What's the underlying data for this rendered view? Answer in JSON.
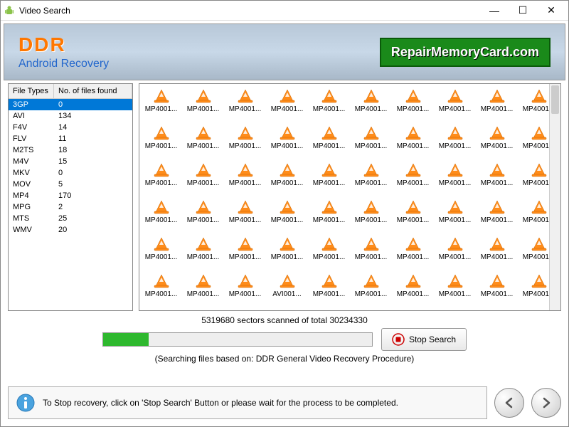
{
  "window": {
    "title": "Video Search"
  },
  "header": {
    "logo": "DDR",
    "subtitle": "Android Recovery",
    "brand": "RepairMemoryCard.com"
  },
  "file_table": {
    "col1": "File Types",
    "col2": "No. of files found",
    "rows": [
      {
        "type": "3GP",
        "count": "0",
        "selected": true
      },
      {
        "type": "AVI",
        "count": "134"
      },
      {
        "type": "F4V",
        "count": "14"
      },
      {
        "type": "FLV",
        "count": "11"
      },
      {
        "type": "M2TS",
        "count": "18"
      },
      {
        "type": "M4V",
        "count": "15"
      },
      {
        "type": "MKV",
        "count": "0"
      },
      {
        "type": "MOV",
        "count": "5"
      },
      {
        "type": "MP4",
        "count": "170"
      },
      {
        "type": "MPG",
        "count": "2"
      },
      {
        "type": "MTS",
        "count": "25"
      },
      {
        "type": "WMV",
        "count": "20"
      }
    ]
  },
  "thumbs": {
    "default_label": "MP4001...",
    "alt_label": "AVI001...",
    "rows": 6,
    "cols": 10,
    "alt_positions": [
      53
    ]
  },
  "progress": {
    "status": "5319680 sectors scanned of total 30234330",
    "percent": 17,
    "note": "(Searching files based on:  DDR General Video Recovery Procedure)",
    "stop_label": "Stop Search"
  },
  "footer": {
    "info": "To Stop recovery, click on 'Stop Search' Button or please wait for the process to be completed."
  }
}
